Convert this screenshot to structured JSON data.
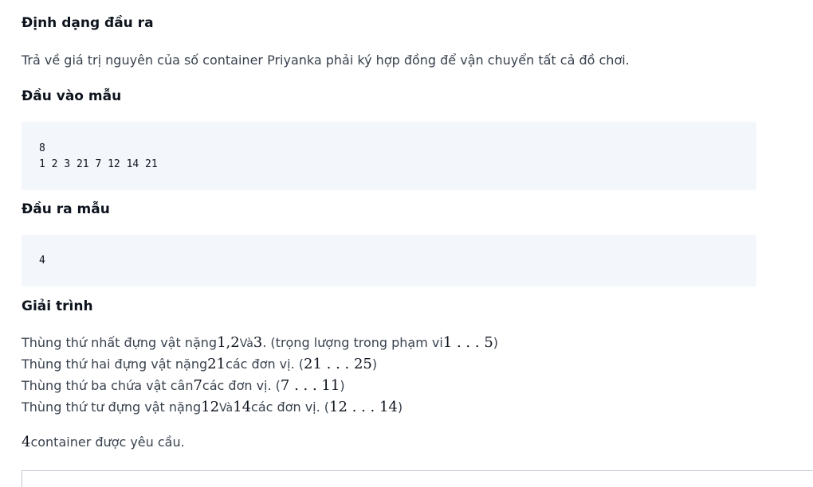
{
  "output_format": {
    "heading": "Định dạng đầu ra",
    "text": "Trả về giá trị nguyên của số container Priyanka phải ký hợp đồng để vận chuyển tất cả đồ chơi."
  },
  "sample_input": {
    "heading": "Đầu vào mẫu",
    "lines": [
      "8",
      "1 2 3 21 7 12 14 21"
    ]
  },
  "sample_output": {
    "heading": "Đầu ra mẫu",
    "lines": [
      "4"
    ]
  },
  "explanation": {
    "heading": "Giải trình",
    "line1": {
      "text1": "Thùng thứ nhất đựng vật nặng",
      "math1": "1",
      "sep": ",",
      "math2": "2",
      "text2": "Và",
      "math3": "3",
      "text3": ". (trọng lượng trong phạm vi",
      "math4": "1 . . . 5",
      "text4": ")"
    },
    "line2": {
      "text1": "Thùng thứ hai đựng vật nặng",
      "math1": "21",
      "text2": "các đơn vị. (",
      "math2": "21 . . . 25",
      "text3": ")"
    },
    "line3": {
      "text1": "Thùng thứ ba chứa vật cân",
      "math1": "7",
      "text2": "các đơn vị. (",
      "math2": "7 . . . 11",
      "text3": ")"
    },
    "line4": {
      "text1": "Thùng thứ tư đựng vật nặng",
      "math1": "12",
      "text2": "Và",
      "math2": "14",
      "text3": "các đơn vị. (",
      "math3": "12 . . . 14",
      "text4": ")"
    },
    "conclusion": {
      "math": "4",
      "text": "container được yêu cầu."
    }
  }
}
